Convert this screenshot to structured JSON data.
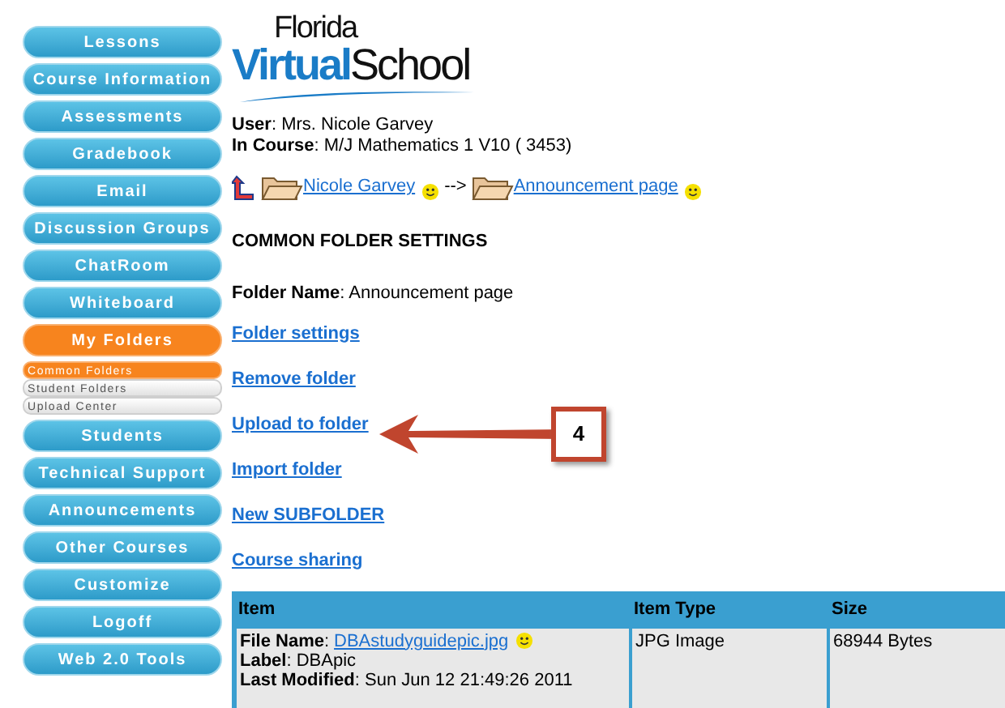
{
  "sidebar": {
    "items": [
      {
        "label": "Lessons",
        "kind": "main",
        "selected": false
      },
      {
        "label": "Course Information",
        "kind": "main",
        "selected": false
      },
      {
        "label": "Assessments",
        "kind": "main",
        "selected": false
      },
      {
        "label": "Gradebook",
        "kind": "main",
        "selected": false
      },
      {
        "label": "Email",
        "kind": "main",
        "selected": false
      },
      {
        "label": "Discussion Groups",
        "kind": "main",
        "selected": false
      },
      {
        "label": "ChatRoom",
        "kind": "main",
        "selected": false
      },
      {
        "label": "Whiteboard",
        "kind": "main",
        "selected": false
      },
      {
        "label": "My Folders",
        "kind": "main",
        "selected": true
      },
      {
        "label": "Common Folders",
        "kind": "sub",
        "selected": true
      },
      {
        "label": "Student Folders",
        "kind": "sub",
        "selected": false
      },
      {
        "label": "Upload Center",
        "kind": "sub",
        "selected": false
      },
      {
        "label": "Students",
        "kind": "main",
        "selected": false
      },
      {
        "label": "Technical Support",
        "kind": "main",
        "selected": false
      },
      {
        "label": "Announcements",
        "kind": "main",
        "selected": false
      },
      {
        "label": "Other Courses",
        "kind": "main",
        "selected": false
      },
      {
        "label": "Customize",
        "kind": "main",
        "selected": false
      },
      {
        "label": "Logoff",
        "kind": "main",
        "selected": false
      },
      {
        "label": "Web 2.0 Tools",
        "kind": "main",
        "selected": false
      }
    ]
  },
  "logo": {
    "top": "Florida",
    "bold": "Virtual",
    "rest": "School"
  },
  "info": [
    "**User**: Mrs. Nicole Garvey",
    "**In Course**: M/J Mathematics 1 V10 ( 3453)"
  ],
  "breadcrumb": {
    "links": [
      "Nicole Garvey",
      "Announcement page"
    ],
    "separator": "-->"
  },
  "heading": "COMMON FOLDER SETTINGS",
  "folder_name": "**Folder Name**: Announcement page",
  "links": [
    "Folder settings",
    "Remove folder",
    "Upload to folder",
    "Import folder",
    "New SUBFOLDER",
    "Course sharing"
  ],
  "callout": {
    "number": "4"
  },
  "table": {
    "columns": [
      "Item",
      "Item Type",
      "Size"
    ],
    "rows": [
      {
        "file_label": "**File Name**:",
        "file": "DBAstudyguidepic.jpg",
        "label": "**Label**: DBApic",
        "modified": "**Last Modified**: Sun Jun 12 21:49:26 2011",
        "type": "JPG Image",
        "size": "68944 Bytes"
      }
    ]
  }
}
